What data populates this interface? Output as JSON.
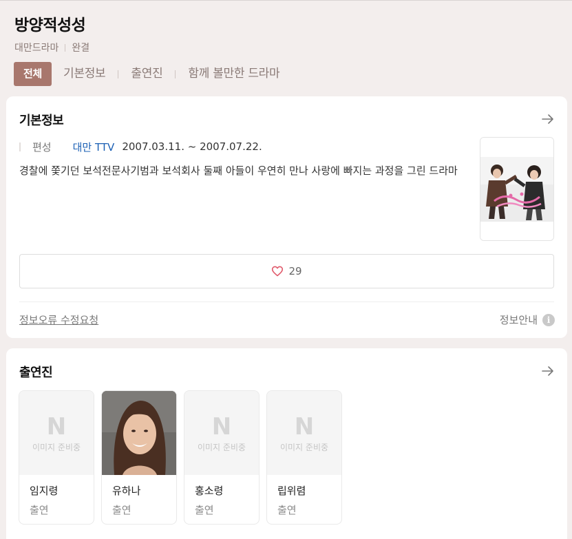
{
  "header": {
    "title": "방양적성성",
    "meta": [
      "대만드라마",
      "완결"
    ]
  },
  "tabs": [
    {
      "label": "전체",
      "active": true
    },
    {
      "label": "기본정보"
    },
    {
      "label": "출연진"
    },
    {
      "label": "함께 볼만한 드라마"
    }
  ],
  "basic_info": {
    "title": "기본정보",
    "arrow_icon": "arrow-right-icon",
    "label": "편성",
    "channel": "대만 TTV",
    "date": "2007.03.11. ~ 2007.07.22.",
    "description": "경찰에 쫓기던 보석전문사기범과 보석회사 둘째 아들이 우연히 만나 사랑에 빠지는 과정을 그린 드라마",
    "likes": "29",
    "like_icon": "heart-icon",
    "report_link": "정보오류 수정요청",
    "guide_label": "정보안내",
    "guide_icon": "info-icon",
    "info_glyph": "i"
  },
  "cast": {
    "title": "출연진",
    "arrow_icon": "arrow-right-icon",
    "placeholder_text": "이미지 준비중",
    "placeholder_letter": "N",
    "members": [
      {
        "name": "임지령",
        "role": "출연"
      },
      {
        "name": "유하나",
        "role": "출연"
      },
      {
        "name": "홍소령",
        "role": "출연"
      },
      {
        "name": "립위렴",
        "role": "출연"
      }
    ]
  },
  "colors": {
    "active_tab": "#a8776d",
    "channel_link": "#1a5fb4",
    "heart": "#e05a6b",
    "background": "#f3eeed"
  }
}
